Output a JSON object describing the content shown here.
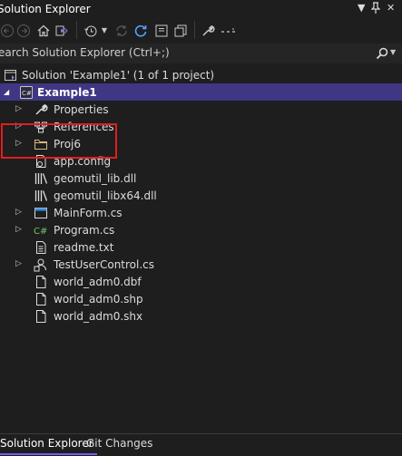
{
  "window": {
    "title": "Solution Explorer",
    "pin_icon": "pin-icon",
    "menu_icon": "dropdown-icon"
  },
  "toolbar": {
    "icons": [
      "back-icon",
      "forward-icon",
      "home-icon",
      "switch-views-icon",
      "history-icon",
      "chevron-down-icon",
      "sync-icon",
      "refresh-icon",
      "collapse-all-icon",
      "show-all-files-icon",
      "properties-icon",
      "preview-icon"
    ]
  },
  "search": {
    "placeholder": "Search Solution Explorer (Ctrl+;)",
    "visible_text": "earch Solution Explorer (Ctrl+;)"
  },
  "tree": {
    "solution": {
      "label": "Solution 'Example1' (1 of 1 project)"
    },
    "project": {
      "label": "Example1",
      "selected": true
    },
    "items": [
      {
        "label": "Properties",
        "icon": "wrench-icon",
        "expandable": true
      },
      {
        "label": "References",
        "icon": "references-icon",
        "expandable": true
      },
      {
        "label": "Proj6",
        "icon": "folder-icon",
        "expandable": true
      },
      {
        "label": "app.config",
        "icon": "config-file-icon",
        "expandable": false
      },
      {
        "label": "geomutil_lib.dll",
        "icon": "library-icon",
        "expandable": false
      },
      {
        "label": "geomutil_libx64.dll",
        "icon": "library-icon",
        "expandable": false
      },
      {
        "label": "MainForm.cs",
        "icon": "form-icon",
        "expandable": true
      },
      {
        "label": "Program.cs",
        "icon": "csharp-file-icon",
        "expandable": true
      },
      {
        "label": "readme.txt",
        "icon": "text-file-icon",
        "expandable": false
      },
      {
        "label": "TestUserControl.cs",
        "icon": "user-control-icon",
        "expandable": true
      },
      {
        "label": "world_adm0.dbf",
        "icon": "file-icon",
        "expandable": false
      },
      {
        "label": "world_adm0.shp",
        "icon": "file-icon",
        "expandable": false
      },
      {
        "label": "world_adm0.shx",
        "icon": "file-icon",
        "expandable": false
      }
    ]
  },
  "tabs": [
    {
      "label": "Solution Explorer",
      "active": true
    },
    {
      "label": "Git Changes",
      "active": false
    }
  ],
  "colors": {
    "background": "#1e1e1e",
    "selection": "#3f3784",
    "highlight_border": "#e01e1e",
    "accent": "#7160e8"
  }
}
